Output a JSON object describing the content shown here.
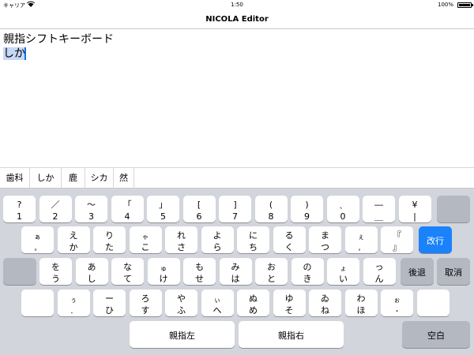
{
  "status_bar": {
    "carrier": "キャリア",
    "time": "1:50",
    "battery": "100%"
  },
  "nav": {
    "title": "NICOLA Editor"
  },
  "editor": {
    "line1": "親指シフトキーボード",
    "line2_marked": "しか"
  },
  "candidates": [
    "歯科",
    "しか",
    "鹿",
    "シカ",
    "然"
  ],
  "keyboard": {
    "row1": [
      {
        "top": "?",
        "bot": "1"
      },
      {
        "top": "／",
        "bot": "2"
      },
      {
        "top": "〜",
        "bot": "3"
      },
      {
        "top": "「",
        "bot": "4"
      },
      {
        "top": "」",
        "bot": "5"
      },
      {
        "top": "[",
        "bot": "6"
      },
      {
        "top": "]",
        "bot": "7"
      },
      {
        "top": "(",
        "bot": "8"
      },
      {
        "top": ")",
        "bot": "9"
      },
      {
        "top": "、",
        "bot": "0"
      },
      {
        "top": "―",
        "bot": "＿"
      },
      {
        "top": "¥",
        "bot": "|"
      }
    ],
    "row2": [
      {
        "top": "ぁ",
        "bot": "。"
      },
      {
        "top": "え",
        "bot": "か"
      },
      {
        "top": "り",
        "bot": "た"
      },
      {
        "top": "ゃ",
        "bot": "こ"
      },
      {
        "top": "れ",
        "bot": "さ"
      },
      {
        "top": "よ",
        "bot": "ら"
      },
      {
        "top": "に",
        "bot": "ち"
      },
      {
        "top": "る",
        "bot": "く"
      },
      {
        "top": "ま",
        "bot": "つ"
      },
      {
        "top": "ぇ",
        "bot": "，"
      },
      {
        "top": "『",
        "bot": "』"
      }
    ],
    "row3": [
      {
        "top": "を",
        "bot": "う"
      },
      {
        "top": "あ",
        "bot": "し"
      },
      {
        "top": "な",
        "bot": "て"
      },
      {
        "top": "ゅ",
        "bot": "け"
      },
      {
        "top": "も",
        "bot": "せ"
      },
      {
        "top": "み",
        "bot": "は"
      },
      {
        "top": "お",
        "bot": "と"
      },
      {
        "top": "の",
        "bot": "き"
      },
      {
        "top": "ょ",
        "bot": "い"
      },
      {
        "top": "っ",
        "bot": "ん"
      }
    ],
    "row4": [
      {
        "top": "",
        "bot": ""
      },
      {
        "top": "ぅ",
        "bot": "．"
      },
      {
        "top": "ー",
        "bot": "ひ"
      },
      {
        "top": "ろ",
        "bot": "す"
      },
      {
        "top": "や",
        "bot": "ふ"
      },
      {
        "top": "ぃ",
        "bot": "へ"
      },
      {
        "top": "ぬ",
        "bot": "め"
      },
      {
        "top": "ゆ",
        "bot": "そ"
      },
      {
        "top": "ゐ",
        "bot": "ね"
      },
      {
        "top": "わ",
        "bot": "ほ"
      },
      {
        "top": "ぉ",
        "bot": "・"
      },
      {
        "top": "",
        "bot": ""
      }
    ],
    "enter": "改行",
    "backspace": "後退",
    "cancel": "取消",
    "left_thumb": "親指左",
    "right_thumb": "親指右",
    "space": "空白"
  },
  "colors": {
    "accent": "#1a82fb",
    "keyboard_bg": "#d2d5db",
    "dark_key": "#b4b8c1",
    "selection": "#c5d8f5"
  }
}
